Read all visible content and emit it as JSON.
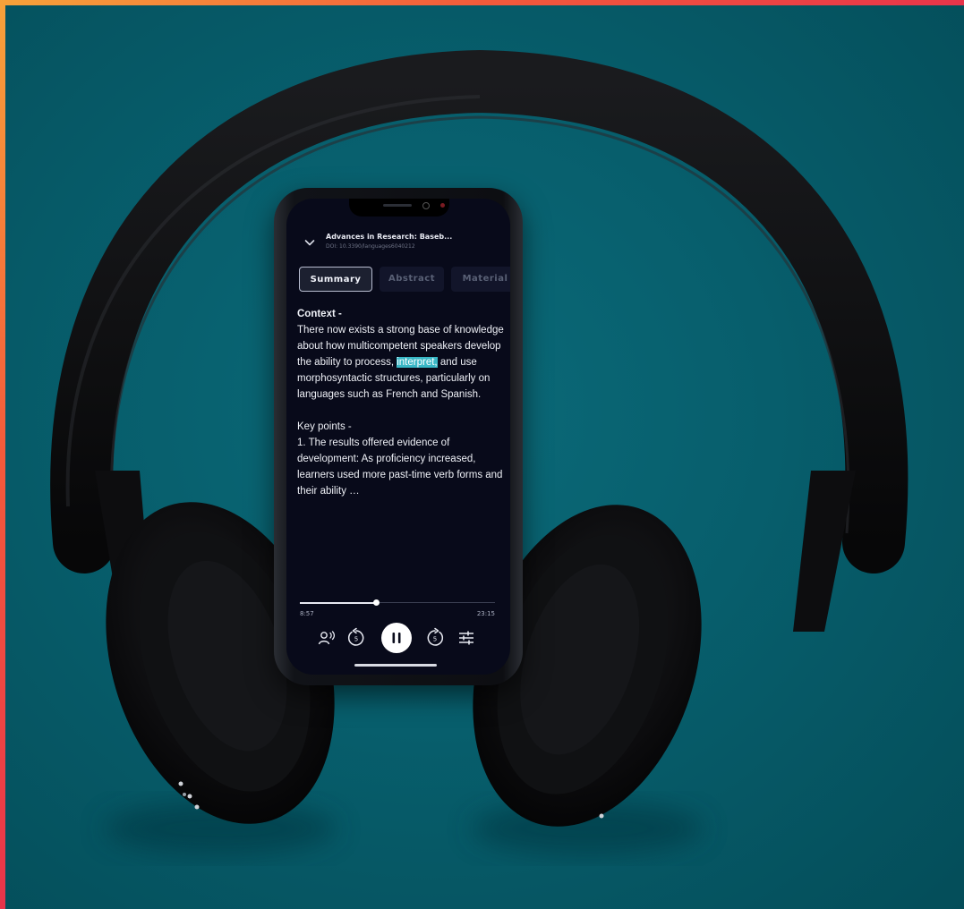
{
  "player": {
    "title": "Advances in Research: Baseb...",
    "doi": "DOI: 10.3390/languages6040212",
    "tabs": [
      {
        "label": "Summary",
        "active": true
      },
      {
        "label": "Abstract",
        "active": false
      },
      {
        "label": "Material",
        "active": false
      }
    ],
    "content": {
      "context_label": "Context -",
      "context_before": "There now exists a strong base of knowledge about how multicompetent speakers develop the ability to process, ",
      "context_highlight": "interpret,",
      "context_after": " and use morphosyntactic structures, particularly on languages such as French and Spanish.",
      "keypoints_label": "Key points -",
      "keypoint_1": "1. The results offered evidence of development: As proficiency increased, learners used more past-time verb forms and their ability …"
    },
    "elapsed": "8:57",
    "total": "23:15",
    "progress_fraction": 0.39,
    "skip_back": "5",
    "skip_forward": "5"
  },
  "colors": {
    "background": "#075e6c",
    "screen": "#080a1a",
    "highlight": "#39b7c6",
    "border_gradient": [
      "#f7a23a",
      "#f25a3b",
      "#e8344a"
    ]
  },
  "icons": [
    "chevron-down-icon",
    "narrator-voice-icon",
    "rewind-5-icon",
    "pause-icon",
    "forward-5-icon",
    "sliders-icon"
  ]
}
